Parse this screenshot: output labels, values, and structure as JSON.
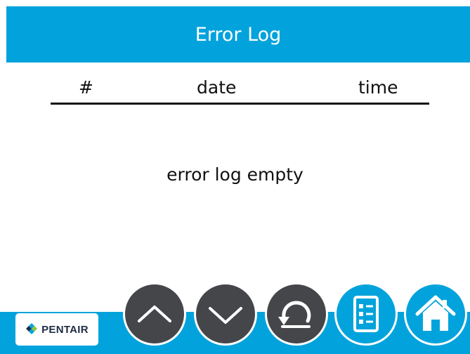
{
  "header": {
    "title": "Error Log"
  },
  "table": {
    "columns": [
      "#",
      "date",
      "time"
    ],
    "empty_message": "error log empty"
  },
  "footer": {
    "logo_text": "PENTAIR",
    "buttons": [
      {
        "icon": "chevron-up-icon"
      },
      {
        "icon": "chevron-down-icon"
      },
      {
        "icon": "back-arrow-icon"
      },
      {
        "icon": "checklist-icon"
      },
      {
        "icon": "home-icon"
      }
    ]
  },
  "colors": {
    "accent": "#02a3dc",
    "button_dark": "#45464a",
    "text": "#111111"
  }
}
